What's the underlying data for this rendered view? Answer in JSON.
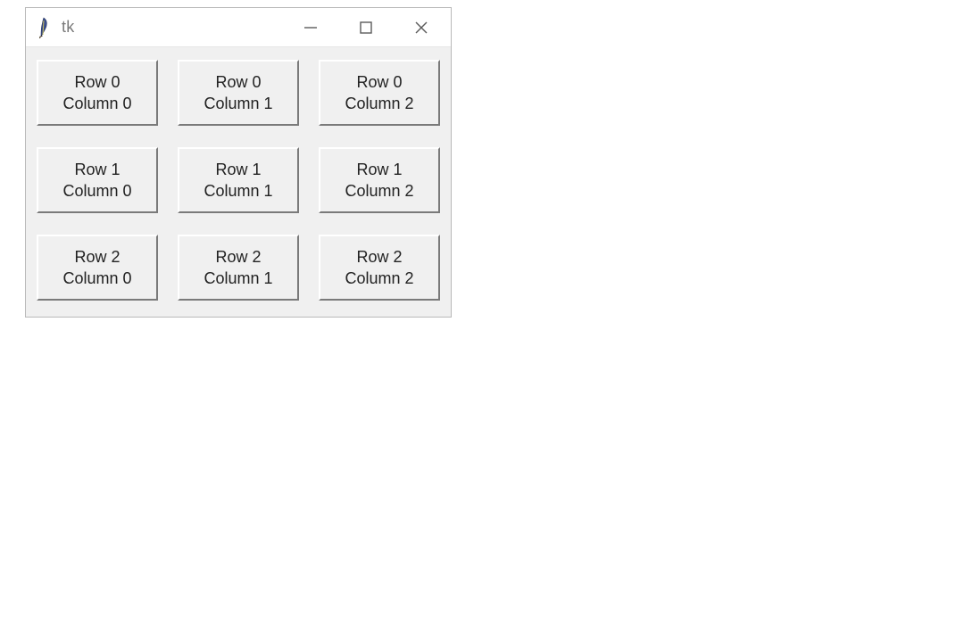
{
  "window": {
    "title": "tk",
    "controls": {
      "minimize": "Minimize",
      "maximize": "Maximize",
      "close": "Close"
    }
  },
  "grid": {
    "rows": [
      [
        {
          "line1": "Row 0",
          "line2": "Column 0"
        },
        {
          "line1": "Row 0",
          "line2": "Column 1"
        },
        {
          "line1": "Row 0",
          "line2": "Column 2"
        }
      ],
      [
        {
          "line1": "Row 1",
          "line2": "Column 0"
        },
        {
          "line1": "Row 1",
          "line2": "Column 1"
        },
        {
          "line1": "Row 1",
          "line2": "Column 2"
        }
      ],
      [
        {
          "line1": "Row 2",
          "line2": "Column 0"
        },
        {
          "line1": "Row 2",
          "line2": "Column 1"
        },
        {
          "line1": "Row 2",
          "line2": "Column 2"
        }
      ]
    ]
  }
}
